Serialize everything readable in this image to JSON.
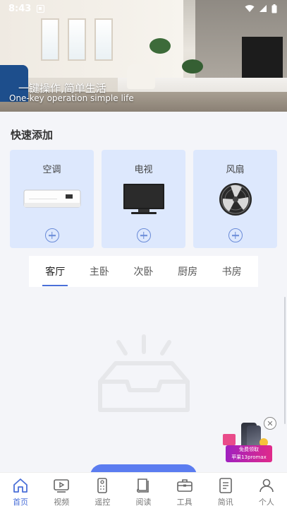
{
  "status_bar": {
    "time": "8:43",
    "icons": [
      "app-notification-icon",
      "wifi-icon",
      "signal-icon",
      "battery-icon"
    ]
  },
  "banner": {
    "title": "一键操作,简单生活",
    "subtitle": "One-key operation simple life"
  },
  "quick_add": {
    "title": "快速添加",
    "devices": [
      {
        "label": "空调",
        "icon": "air-conditioner-icon",
        "action_icon": "plus-circle-icon"
      },
      {
        "label": "电视",
        "icon": "tv-icon",
        "action_icon": "plus-circle-icon"
      },
      {
        "label": "风扇",
        "icon": "fan-icon",
        "action_icon": "plus-circle-icon"
      }
    ]
  },
  "rooms": {
    "tabs": [
      "客厅",
      "主卧",
      "次卧",
      "厨房",
      "书房"
    ],
    "active_tab": "客厅"
  },
  "empty_state": {
    "icon": "empty-inbox-icon"
  },
  "ad": {
    "line1": "免费领取",
    "line2": "苹果13promax"
  },
  "bottom_nav": {
    "items": [
      {
        "label": "首页",
        "icon": "home-icon",
        "active": true
      },
      {
        "label": "视频",
        "icon": "video-icon",
        "active": false
      },
      {
        "label": "遥控",
        "icon": "remote-icon",
        "active": false
      },
      {
        "label": "阅读",
        "icon": "book-icon",
        "active": false
      },
      {
        "label": "工具",
        "icon": "toolbox-icon",
        "active": false
      },
      {
        "label": "简讯",
        "icon": "news-icon",
        "active": false
      },
      {
        "label": "个人",
        "icon": "person-icon",
        "active": false
      }
    ]
  },
  "colors": {
    "accent": "#4a6fd8",
    "card_bg": "#dde8fd",
    "page_bg": "#f4f5f9"
  }
}
